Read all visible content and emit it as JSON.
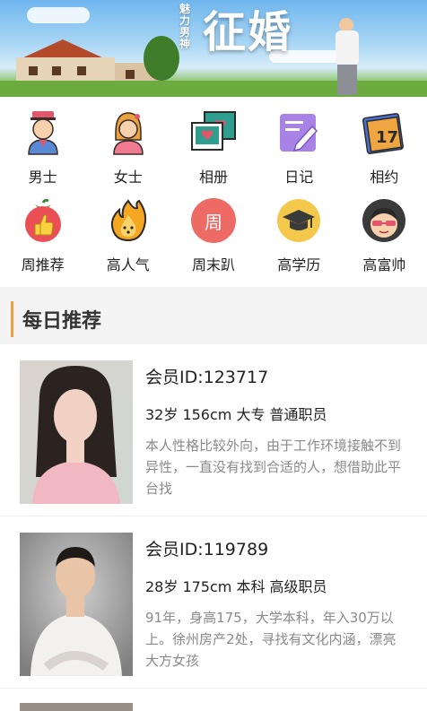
{
  "banner": {
    "tagline": "魅力男神",
    "title": "征婚"
  },
  "categories": [
    {
      "label": "男士",
      "icon": "man-icon"
    },
    {
      "label": "女士",
      "icon": "woman-icon"
    },
    {
      "label": "相册",
      "icon": "photo-album-icon"
    },
    {
      "label": "日记",
      "icon": "diary-icon"
    },
    {
      "label": "相约",
      "icon": "appointment-calendar-icon"
    },
    {
      "label": "周推荐",
      "icon": "thumbs-up-icon"
    },
    {
      "label": "高人气",
      "icon": "flame-icon"
    },
    {
      "label": "周末趴",
      "icon": "weekend-party-icon",
      "glyph": "周"
    },
    {
      "label": "高学历",
      "icon": "graduation-cap-icon"
    },
    {
      "label": "高富帅",
      "icon": "cool-guy-icon"
    }
  ],
  "section": {
    "title": "每日推荐"
  },
  "members": [
    {
      "id_text": "会员ID:123717",
      "stats": "32岁 156cm 大专 普通职员",
      "description": "本人性格比较外向，由于工作环境接触不到异性，一直没有找到合适的人，想借助此平台找"
    },
    {
      "id_text": "会员ID:119789",
      "stats": "28岁 175cm 本科 高级职员",
      "description": "91年，身高175，大学本科，年入30万以上。徐州房产2处，寻找有文化内涵，漂亮大方女孩"
    }
  ],
  "colors": {
    "accent": "#e9a23b",
    "section_bg": "#f4f4f4",
    "muted_text": "#8a8a8a"
  }
}
